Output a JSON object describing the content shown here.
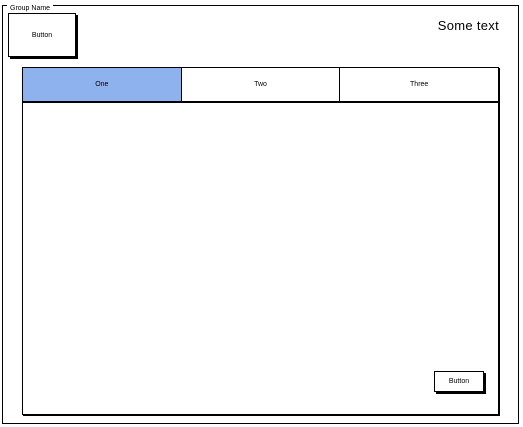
{
  "group": {
    "name": "Group Name"
  },
  "header": {
    "button_label": "Button",
    "text": "Some text"
  },
  "tabs": [
    {
      "label": "One",
      "active": true
    },
    {
      "label": "Two",
      "active": false
    },
    {
      "label": "Three",
      "active": false
    }
  ],
  "panel": {
    "button_label": "Button"
  },
  "colors": {
    "active_tab": "#8eb2ee",
    "border": "#000000",
    "background": "#ffffff"
  }
}
